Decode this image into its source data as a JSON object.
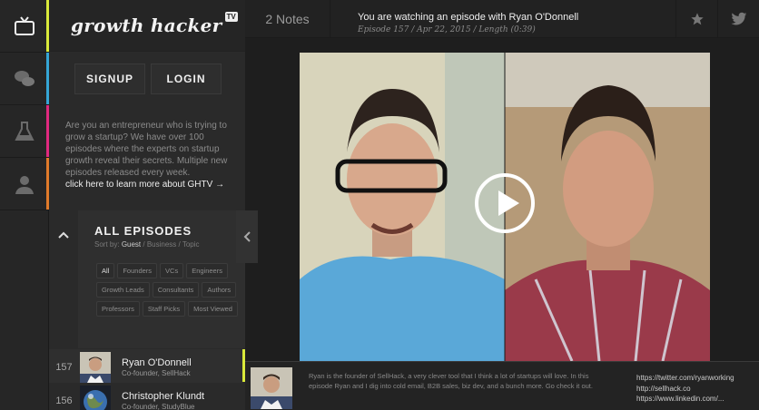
{
  "brand": {
    "logo_text": "growth hacker",
    "badge": "TV"
  },
  "rail": [
    {
      "icon": "tv-icon",
      "accent": "#d9e93a"
    },
    {
      "icon": "chat-bubbles-icon",
      "accent": "#35a6d6"
    },
    {
      "icon": "flask-icon",
      "accent": "#e0297f"
    },
    {
      "icon": "person-icon",
      "accent": "#e07a2a"
    }
  ],
  "auth": {
    "signup": "SIGNUP",
    "login": "LOGIN"
  },
  "blurb": {
    "text": "Are you an entrepreneur who is trying to grow a startup? We have over 100 episodes where the experts on startup growth reveal their secrets. Multiple new episodes released every week.",
    "link": "click here to learn more about GHTV →"
  },
  "episodes_panel": {
    "title": "ALL EPISODES",
    "sort_prefix": "Sort by:",
    "sort_active": "Guest",
    "sort_rest": "/ Business / Topic",
    "tags": [
      "All",
      "Founders",
      "VCs",
      "Engineers",
      "Growth Leads",
      "Consultants",
      "Authors",
      "Professors",
      "Staff Picks",
      "Most Viewed"
    ]
  },
  "episode_list": [
    {
      "number": "157",
      "name": "Ryan O'Donnell",
      "role": "Co-founder, SellHack"
    },
    {
      "number": "156",
      "name": "Christopher Klundt",
      "role": "Co-founder, StudyBlue"
    }
  ],
  "topbar": {
    "notes": "2 Notes",
    "watching": "You are watching an episode with Ryan O'Donnell",
    "meta": "Episode 157 / Apr 22, 2015 / Length (0:39)"
  },
  "info": {
    "description": "Ryan is the founder of SellHack, a very clever tool that I think a lot of startups will love. In this episode Ryan and I dig into cold email, B2B sales, biz dev, and a bunch more. Go check it out.",
    "links": [
      "https://twitter.com/ryanworking",
      "http://sellhack.co",
      "https://www.linkedin.com/..."
    ]
  }
}
